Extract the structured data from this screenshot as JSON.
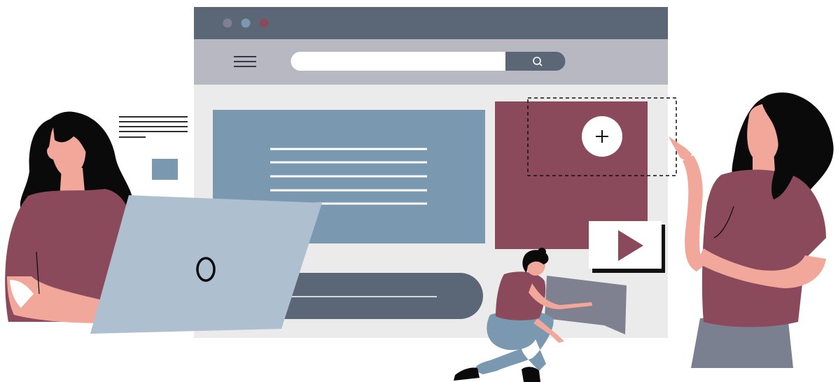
{
  "colors": {
    "titlebar": "#5b6676",
    "toolbar": "#b8b8c2",
    "content_bg": "#ebebeb",
    "panel_blue": "#7a99b0",
    "panel_maroon": "#8a4a5c",
    "dark_bar": "#5b6676",
    "laptop": "#aebfd0",
    "skin": "#f2a79b",
    "hair": "#0a0a0a",
    "shirt": "#8a4a5c",
    "pants": "#7a8090",
    "jeans": "#7a99b0",
    "dot_1": "#7f8090",
    "dot_2": "#7a99b0",
    "dot_3": "#8a4a5c"
  },
  "browser": {
    "window_dots": [
      "dot-gray",
      "dot-blue",
      "dot-maroon"
    ],
    "menu_icon": "hamburger-menu-icon",
    "search_icon": "search-icon",
    "search_value": "",
    "add_icon": "plus-icon",
    "play_icon": "play-icon"
  },
  "laptop": {
    "logo_icon": "laptop-logo-icon"
  }
}
